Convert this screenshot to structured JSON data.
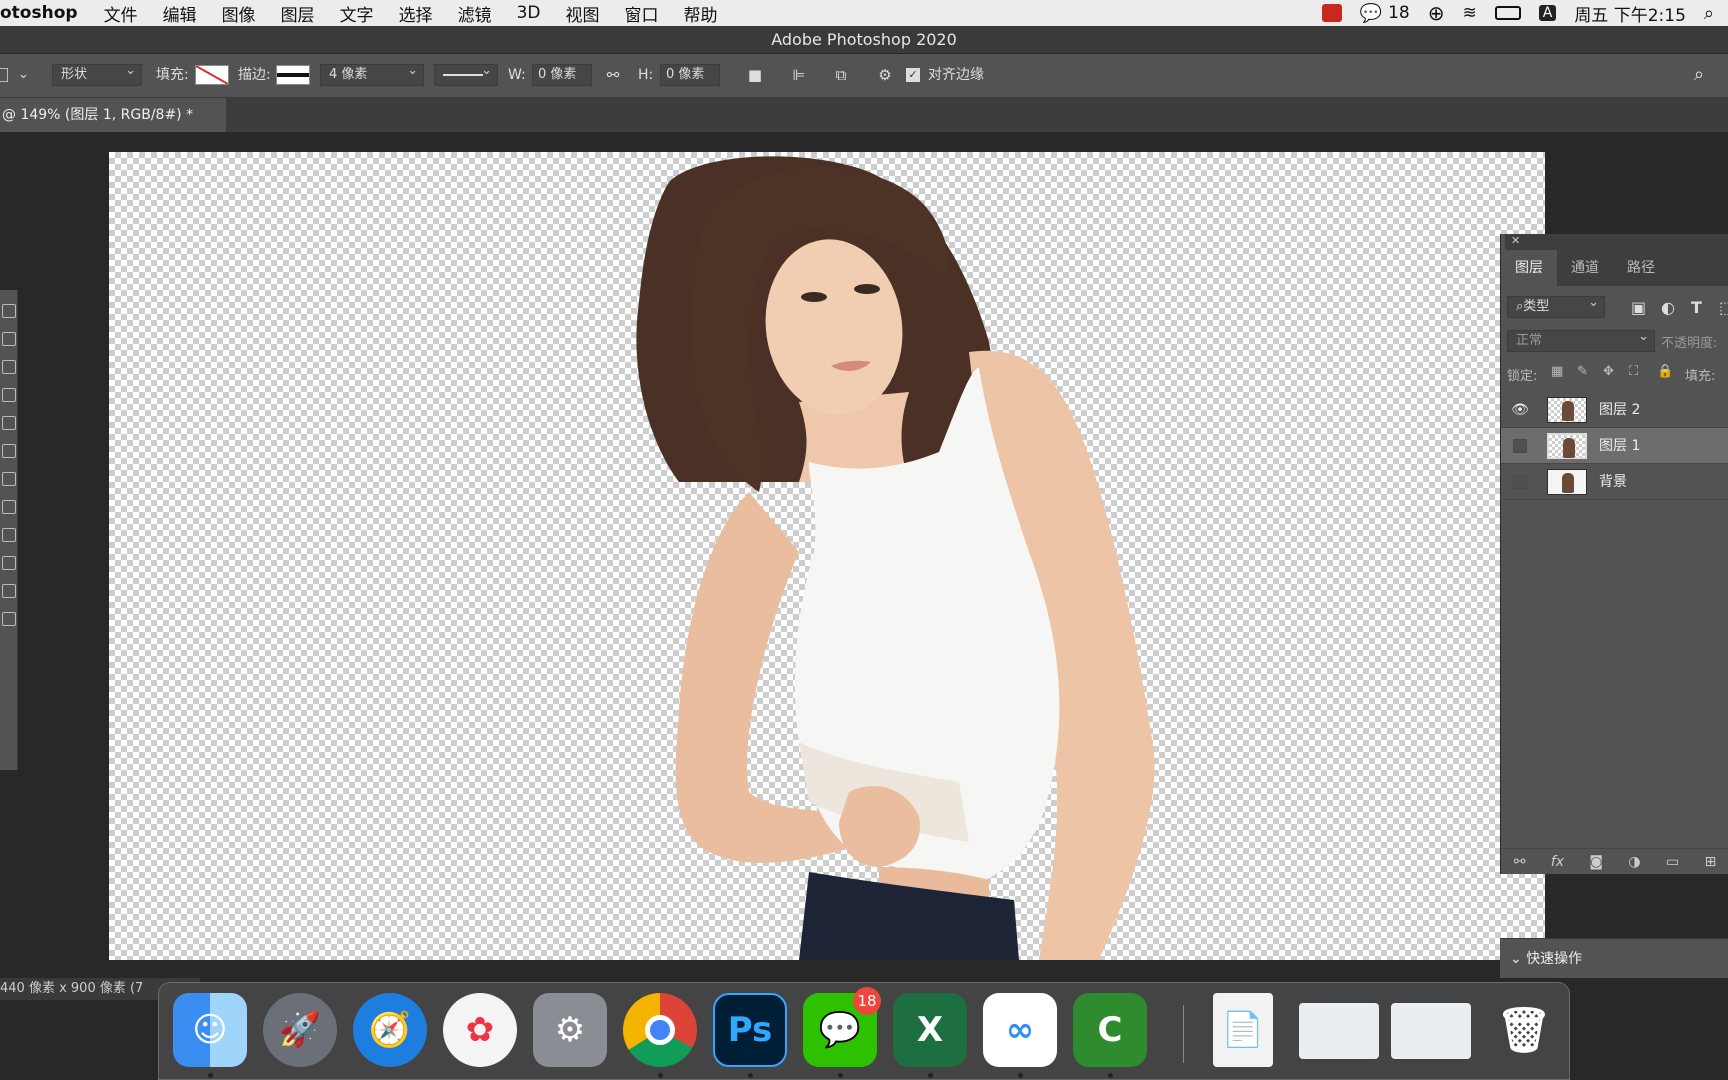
{
  "menubar": {
    "app_name": "otoshop",
    "items": [
      "文件",
      "编辑",
      "图像",
      "图层",
      "文字",
      "选择",
      "滤镜",
      "3D",
      "视图",
      "窗口",
      "帮助"
    ],
    "wechat_count": "18",
    "input_method": "A",
    "clock": "周五 下午2:15"
  },
  "window_title": "Adobe Photoshop 2020",
  "options": {
    "shape_mode": "形状",
    "fill_label": "填充:",
    "stroke_label": "描边:",
    "stroke_width": "4 像素",
    "w_label": "W:",
    "w_value": "0 像素",
    "h_label": "H:",
    "h_value": "0 像素",
    "align_edges_label": "对齐边缘"
  },
  "document": {
    "tab_title": "@ 149% (图层 1, RGB/8#) *",
    "status": "440 像素 x 900 像素 (7"
  },
  "layers_panel": {
    "tabs": [
      "图层",
      "通道",
      "路径"
    ],
    "filter_label": "类型",
    "blend_mode": "正常",
    "opacity_label": "不透明度:",
    "lock_label": "锁定:",
    "fill_label": "填充:",
    "layers": [
      {
        "name": "图层 2",
        "visible": true,
        "selected": false
      },
      {
        "name": "图层 1",
        "visible": false,
        "selected": true
      },
      {
        "name": "背景",
        "visible": false,
        "selected": false
      }
    ]
  },
  "quick_actions": "快速操作",
  "dock": {
    "photoshop_label": "Ps",
    "wechat_badge": "18",
    "excel_label": "X"
  },
  "colors": {
    "panel_bg": "#535353",
    "canvas_bg": "#282828",
    "accent_red": "#f0453a"
  }
}
